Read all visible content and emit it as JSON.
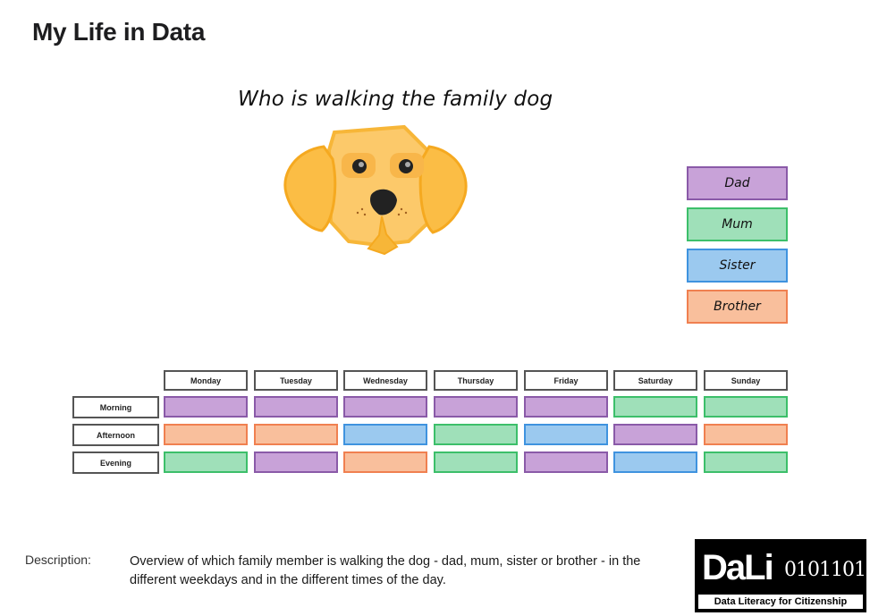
{
  "header": {
    "title": "My Life in Data"
  },
  "description": {
    "label": "Description:",
    "text": "Overview of which family member is walking the dog - dad, mum, sister or brother - in the different weekdays and in the different times of the day."
  },
  "logo": {
    "main": "DaLi",
    "bits": "0101101",
    "tagline": "Data Literacy for Citizenship"
  },
  "illustration": {
    "icon": "dog-face-icon"
  },
  "chart_data": {
    "type": "heatmap",
    "title": "Who is walking the family dog",
    "x": [
      "Monday",
      "Tuesday",
      "Wednesday",
      "Thursday",
      "Friday",
      "Saturday",
      "Sunday"
    ],
    "y": [
      "Morning",
      "Afternoon",
      "Evening"
    ],
    "legend": [
      {
        "name": "Dad",
        "fill": "#c8a2d8",
        "border": "#8a5aa8"
      },
      {
        "name": "Mum",
        "fill": "#9fe0b9",
        "border": "#3cbf6a"
      },
      {
        "name": "Sister",
        "fill": "#9bc9ef",
        "border": "#3f93df"
      },
      {
        "name": "Brother",
        "fill": "#f9bf9c",
        "border": "#f08050"
      }
    ],
    "legend_position": "right",
    "values": [
      [
        "Dad",
        "Dad",
        "Dad",
        "Dad",
        "Dad",
        "Mum",
        "Mum"
      ],
      [
        "Brother",
        "Brother",
        "Sister",
        "Mum",
        "Sister",
        "Dad",
        "Brother"
      ],
      [
        "Mum",
        "Dad",
        "Brother",
        "Mum",
        "Dad",
        "Sister",
        "Mum"
      ]
    ]
  }
}
